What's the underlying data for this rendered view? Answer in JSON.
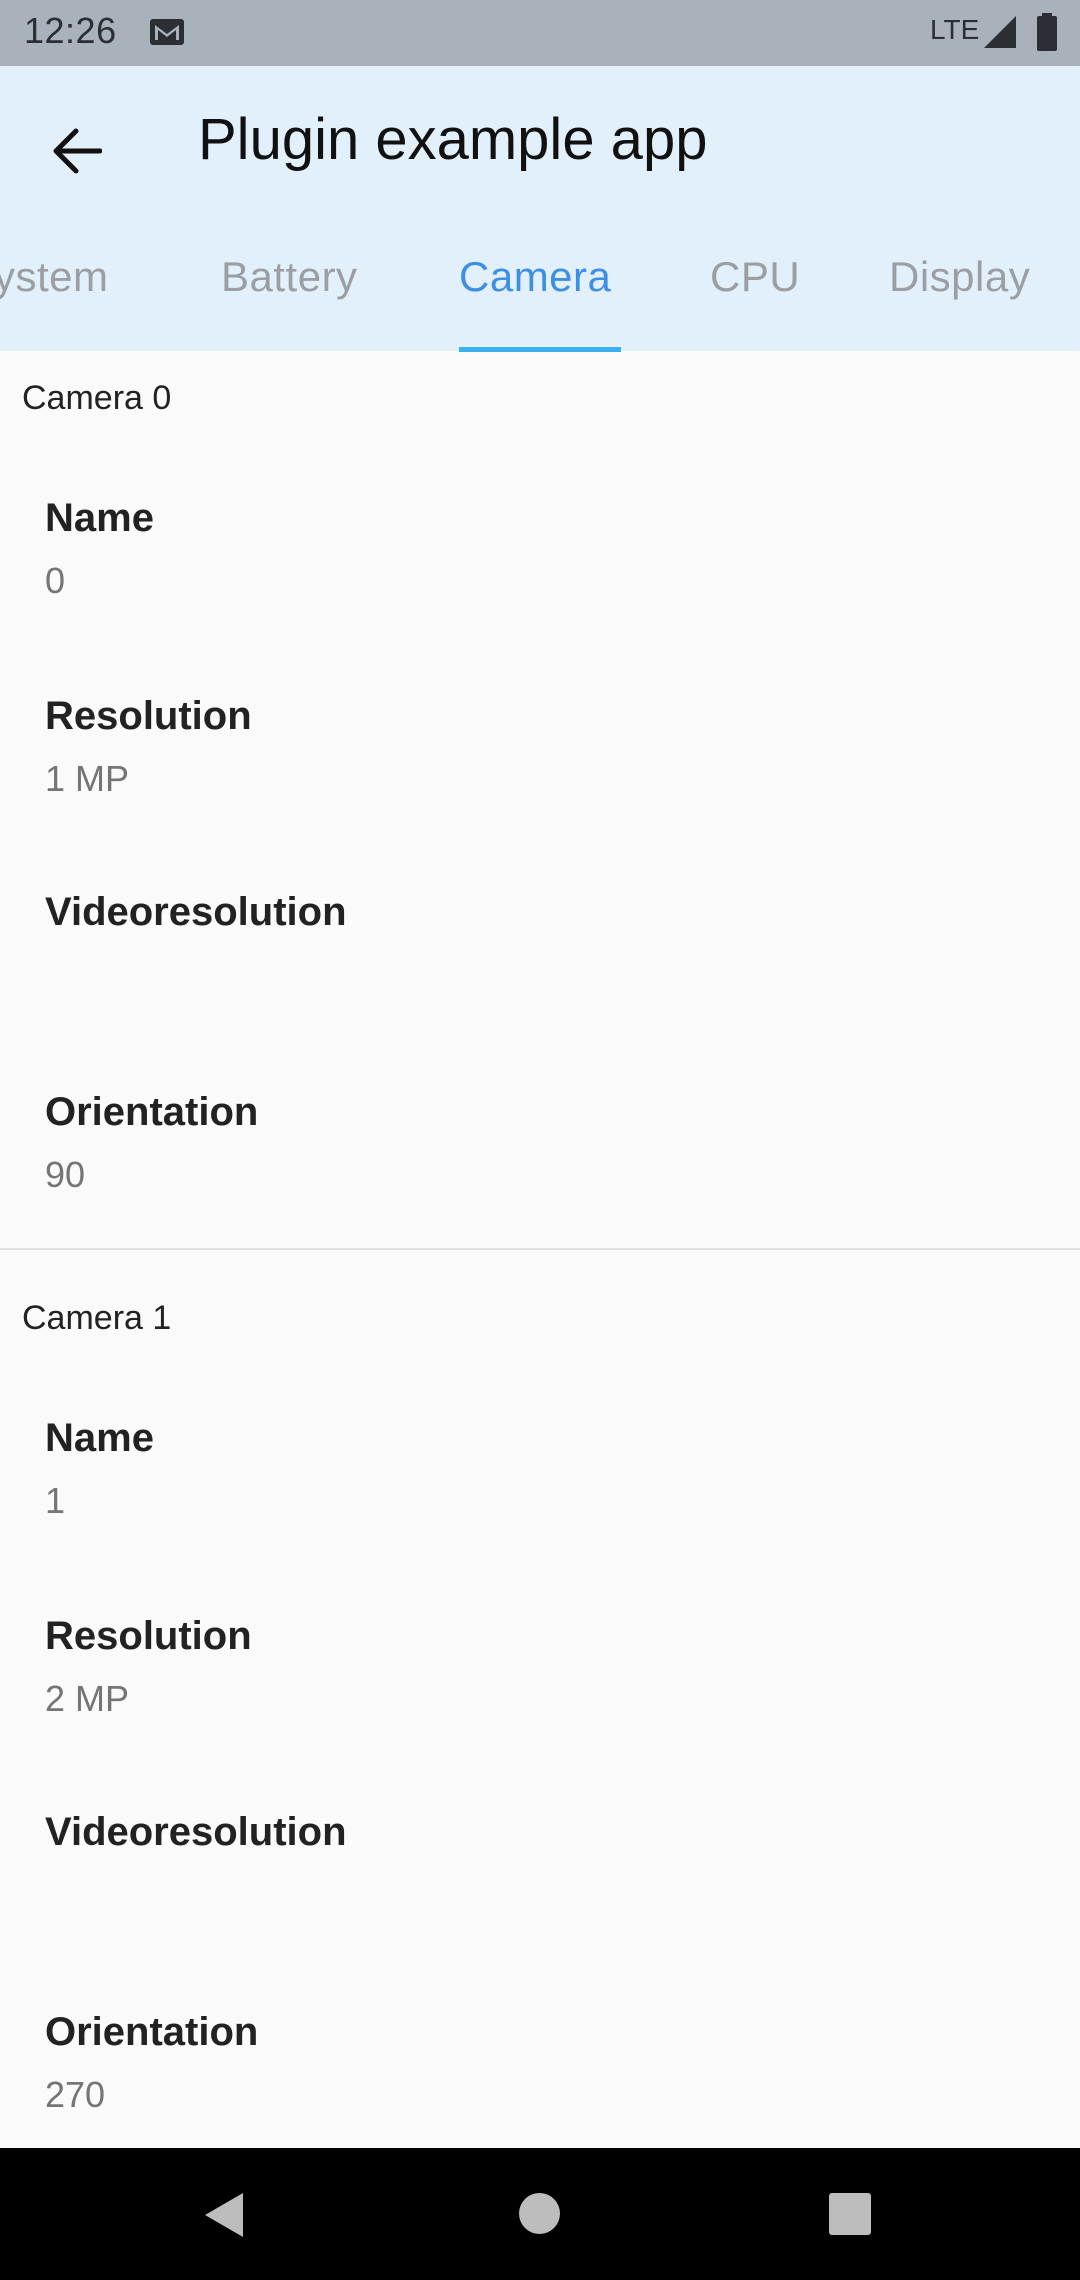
{
  "status_bar": {
    "time": "12:26",
    "network": "LTE",
    "icons": [
      "gmail-icon",
      "signal-icon",
      "battery-icon"
    ]
  },
  "app_bar": {
    "title": "Plugin example app",
    "back_icon": "arrow-back-icon",
    "background": "#e2f0fb"
  },
  "tabs": [
    {
      "label": "ystem",
      "active": false
    },
    {
      "label": "Battery",
      "active": false
    },
    {
      "label": "Camera",
      "active": true
    },
    {
      "label": "CPU",
      "active": false
    },
    {
      "label": "Display",
      "active": false
    }
  ],
  "accent_color": "#3d8fe6",
  "cameras": [
    {
      "header": "Camera 0",
      "items": [
        {
          "label": "Name",
          "value": "0"
        },
        {
          "label": "Resolution",
          "value": "1 MP"
        },
        {
          "label": "Videoresolution",
          "value": ""
        },
        {
          "label": "Orientation",
          "value": "90"
        }
      ]
    },
    {
      "header": "Camera 1",
      "items": [
        {
          "label": "Name",
          "value": "1"
        },
        {
          "label": "Resolution",
          "value": "2 MP"
        },
        {
          "label": "Videoresolution",
          "value": ""
        },
        {
          "label": "Orientation",
          "value": "270"
        }
      ]
    }
  ],
  "nav_bar": {
    "buttons": [
      "nav-back-icon",
      "nav-home-icon",
      "nav-recents-icon"
    ]
  }
}
